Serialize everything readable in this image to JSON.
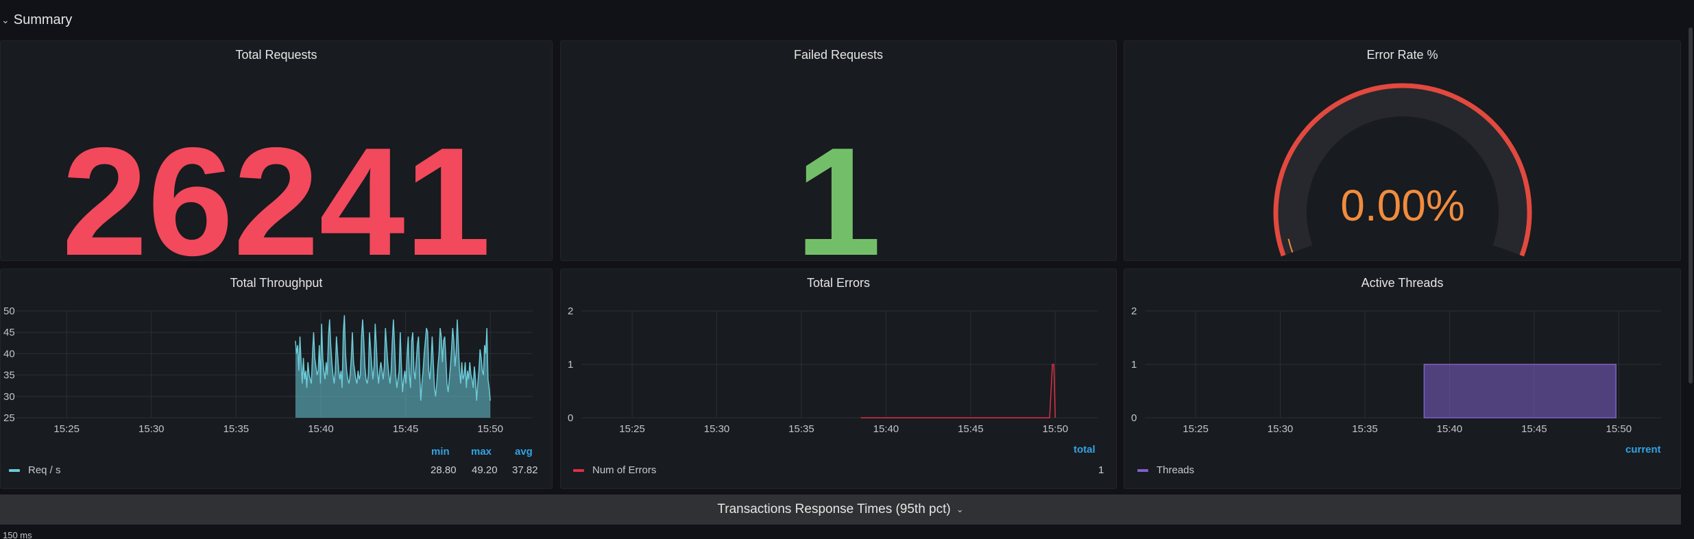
{
  "row": {
    "title": "Summary",
    "chevron_icon": "chevron-down-icon"
  },
  "total_requests": {
    "title": "Total Requests",
    "value": "26241",
    "color": "#f2495c"
  },
  "failed_requests": {
    "title": "Failed Requests",
    "value": "1",
    "color": "#73bf69"
  },
  "error_rate": {
    "title": "Error Rate %",
    "value": "0.00%",
    "value_color": "#f18c3e",
    "arc_color": "#e2493f",
    "threshold_color": "#f18c3e",
    "track_color": "#26282d"
  },
  "throughput": {
    "title": "Total Throughput",
    "legend": {
      "series": "Req / s",
      "headers": [
        "min",
        "max",
        "avg"
      ],
      "values": [
        "28.80",
        "49.20",
        "37.82"
      ],
      "color": "#6ccbd8"
    }
  },
  "errors": {
    "title": "Total Errors",
    "legend": {
      "series": "Num of Errors",
      "headers": [
        "total"
      ],
      "values": [
        "1"
      ],
      "color": "#e02f44"
    }
  },
  "threads": {
    "title": "Active Threads",
    "legend": {
      "series": "Threads",
      "headers": [
        "current"
      ],
      "values": [
        ""
      ],
      "color": "#8060c8"
    }
  },
  "collapsed_row": {
    "title": "Transactions Response Times (95th pct)",
    "chevron_icon": "chevron-down-icon"
  },
  "next_panel": {
    "axis_label": "150 ms"
  },
  "chart_data": [
    {
      "type": "area",
      "title": "Total Throughput",
      "x_ticks": [
        "15:25",
        "15:30",
        "15:35",
        "15:40",
        "15:45",
        "15:50"
      ],
      "y_ticks": [
        25,
        30,
        35,
        40,
        45,
        50
      ],
      "ylim": [
        25,
        50
      ],
      "grid": true,
      "series": [
        {
          "name": "Req / s",
          "x_start": "15:38:30",
          "x_end": "15:50",
          "values": [
            43,
            40,
            42,
            36,
            44,
            38,
            33,
            39,
            34,
            36,
            32,
            38,
            35,
            34,
            33,
            40,
            45,
            39,
            37,
            35,
            36,
            42,
            33,
            47,
            39,
            36,
            34,
            38,
            35,
            44,
            48,
            42,
            38,
            35,
            33,
            36,
            44,
            40,
            36,
            34,
            36,
            32,
            45,
            49,
            40,
            36,
            34,
            33,
            35,
            39,
            45,
            38,
            36,
            34,
            33,
            36,
            34,
            35,
            44,
            48,
            43,
            37,
            34,
            33,
            35,
            45,
            41,
            37,
            34,
            37,
            47,
            42,
            36,
            33,
            36,
            38,
            36,
            34,
            37,
            46,
            42,
            38,
            35,
            33,
            36,
            43,
            48,
            42,
            35,
            32,
            34,
            36,
            45,
            37,
            31,
            34,
            36,
            33,
            40,
            44,
            35,
            32,
            43,
            45,
            36,
            34,
            38,
            42,
            44,
            36,
            29,
            33,
            36,
            40,
            43,
            46,
            45,
            36,
            34,
            38,
            44,
            38,
            32,
            30,
            33,
            37,
            40,
            46,
            44,
            38,
            43,
            44,
            39,
            33,
            31,
            34,
            37,
            41,
            46,
            43,
            37,
            40,
            48,
            42,
            36,
            33,
            38,
            34,
            35,
            38,
            32,
            36,
            34,
            38,
            35,
            34,
            32,
            37,
            34,
            29,
            33,
            36,
            41,
            39,
            36,
            35,
            42,
            40,
            46,
            34,
            32,
            29
          ]
        }
      ]
    },
    {
      "type": "line",
      "title": "Total Errors",
      "x_ticks": [
        "15:25",
        "15:30",
        "15:35",
        "15:40",
        "15:45",
        "15:50"
      ],
      "y_ticks": [
        0,
        1,
        2
      ],
      "ylim": [
        0,
        2
      ],
      "grid": true,
      "series": [
        {
          "name": "Num of Errors",
          "points": [
            [
              "15:38:30",
              0
            ],
            [
              "15:49:40",
              0
            ],
            [
              "15:49:50",
              1
            ],
            [
              "15:49:55",
              1
            ],
            [
              "15:50:00",
              0
            ]
          ]
        }
      ]
    },
    {
      "type": "area",
      "title": "Active Threads",
      "x_ticks": [
        "15:25",
        "15:30",
        "15:35",
        "15:40",
        "15:45",
        "15:50"
      ],
      "y_ticks": [
        0,
        1,
        2
      ],
      "ylim": [
        0,
        2
      ],
      "grid": true,
      "series": [
        {
          "name": "Threads",
          "points": [
            [
              "15:38:30",
              1
            ],
            [
              "15:49:50",
              1
            ]
          ]
        }
      ]
    }
  ]
}
